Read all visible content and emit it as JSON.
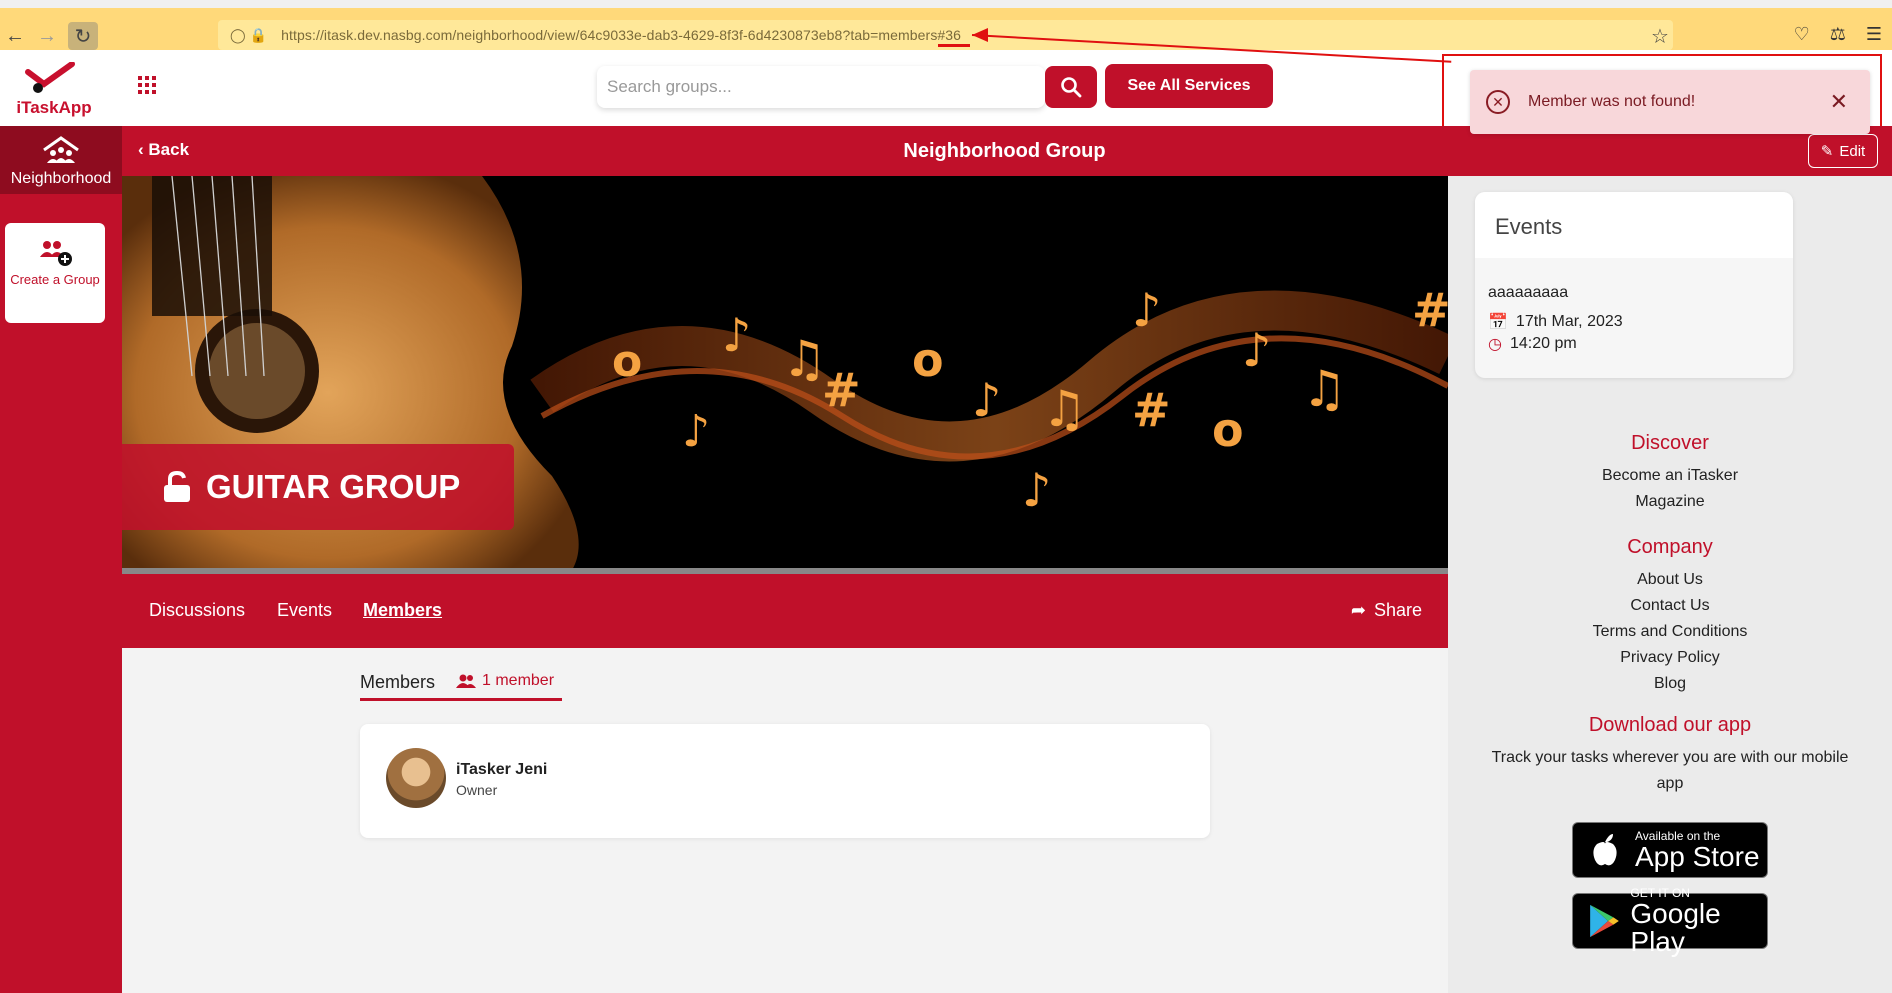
{
  "browser": {
    "url": "https://itask.dev.nasbg.com/neighborhood/view/64c9033e-dab3-4629-8f3f-6d4230873eb8?tab=members#36"
  },
  "header": {
    "logo_text": "iTaskApp",
    "search_placeholder": "Search groups...",
    "services_label": "See All Services"
  },
  "toast": {
    "message": "Member was not found!"
  },
  "sidebar": {
    "nav_label": "Neighborhood",
    "create_label": "Create a Group"
  },
  "titlebar": {
    "back_label": "Back",
    "title": "Neighborhood Group",
    "edit_label": "Edit"
  },
  "banner": {
    "group_name": "GUITAR GROUP"
  },
  "tabs": {
    "items": [
      {
        "label": "Discussions"
      },
      {
        "label": "Events"
      },
      {
        "label": "Members"
      }
    ],
    "active_index": 2,
    "share_label": "Share"
  },
  "members": {
    "heading": "Members",
    "count_label": "1 member",
    "list": [
      {
        "name": "iTasker Jeni",
        "role": "Owner"
      }
    ]
  },
  "events_widget": {
    "title": "Events",
    "event": {
      "name": "aaaaaaaaa",
      "date": "17th Mar, 2023",
      "time": "14:20 pm"
    }
  },
  "footer": {
    "discover": {
      "heading": "Discover",
      "links": [
        "Become an iTasker",
        "Magazine"
      ]
    },
    "company": {
      "heading": "Company",
      "links": [
        "About Us",
        "Contact Us",
        "Terms and Conditions",
        "Privacy Policy",
        "Blog"
      ]
    },
    "download": {
      "heading": "Download our app",
      "text": "Track your tasks wherever you are with our mobile app",
      "app_store_small": "Available on the",
      "app_store_big": "App Store",
      "google_small": "GET IT ON",
      "google_big": "Google Play"
    }
  },
  "colors": {
    "brand": "#c0102a",
    "toast_bg": "#f8d7da",
    "annotation": "#e01010"
  }
}
